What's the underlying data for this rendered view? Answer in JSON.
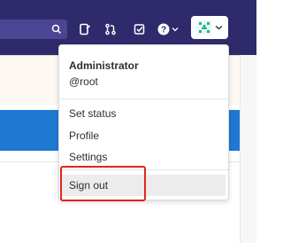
{
  "navbar": {
    "icons": [
      "search-icon",
      "todo-icon",
      "merge-request-icon",
      "issues-icon",
      "help-icon",
      "avatar-icon"
    ]
  },
  "user_menu": {
    "name": "Administrator",
    "handle": "@root",
    "items": [
      {
        "label": "Set status"
      },
      {
        "label": "Profile"
      },
      {
        "label": "Settings"
      },
      {
        "label": "Sign out"
      }
    ]
  },
  "colors": {
    "navbar": "#2f2a6b",
    "blue_band": "#1f78d1",
    "highlight": "#e0261d"
  }
}
